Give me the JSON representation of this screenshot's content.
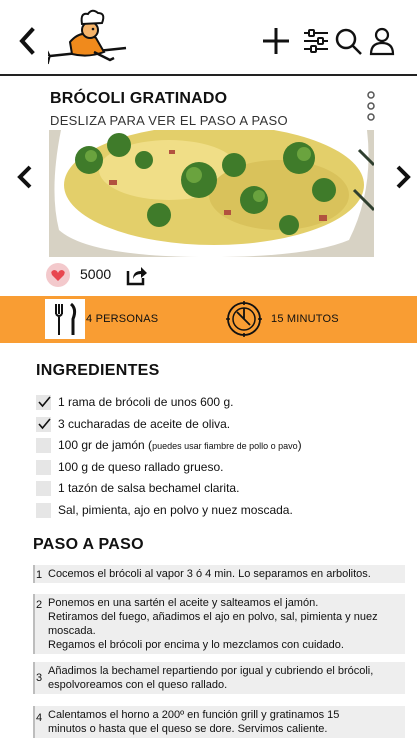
{
  "recipe": {
    "title": "BRÓCOLI GRATINADO",
    "subtitle": "DESLIZA PARA VER EL PASO A PASO",
    "likes": "5000"
  },
  "info": {
    "persons": "4 PERSONAS",
    "time": "15 MINUTOS"
  },
  "ingredients": {
    "heading": "INGREDIENTES",
    "items": [
      {
        "text": "1 rama de brócoli de unos 600 g.",
        "checked": true
      },
      {
        "text": "3 cucharadas de aceite de oliva.",
        "checked": true
      },
      {
        "text": "100 gr de jamón (",
        "note": "puedes usar fiambre de pollo o pavo",
        "suffix": ")",
        "checked": false
      },
      {
        "text": "100 g de queso rallado grueso.",
        "checked": false
      },
      {
        "text": "1 tazón de salsa bechamel clarita.",
        "checked": false
      },
      {
        "text": "Sal, pimienta, ajo en polvo y nuez moscada.",
        "checked": false
      }
    ]
  },
  "steps": {
    "heading": "PASO A PASO",
    "items": [
      {
        "num": "1",
        "lines": [
          "Cocemos el brócoli al vapor 3 ó 4 min.  Lo separamos en arbolitos."
        ]
      },
      {
        "num": "2",
        "lines": [
          "Ponemos en una sartén el aceite y salteamos el jamón.",
          "Retiramos del fuego, añadimos el ajo en polvo, sal, pimienta y nuez",
          "moscada.",
          "Regamos el brócoli por encima y lo mezclamos con cuidado."
        ]
      },
      {
        "num": "3",
        "lines": [
          "Añadimos la bechamel repartiendo por igual y cubriendo el brócoli,",
          "espolvoreamos con el queso rallado."
        ]
      },
      {
        "num": "4",
        "lines": [
          "Calentamos el horno a 200º en función grill y gratinamos 15",
          "minutos o hasta que el queso se dore. Servimos caliente."
        ]
      }
    ]
  },
  "colors": {
    "accent": "#f99d33",
    "like": "#e8464f"
  },
  "icons": {
    "back": "chevron-left-icon",
    "add": "plus-icon",
    "filter": "sliders-icon",
    "search": "search-icon",
    "profile": "user-icon",
    "more": "vertical-dots-icon",
    "prev": "chevron-left-icon",
    "next": "chevron-right-icon",
    "like": "heart-icon",
    "share": "share-icon",
    "persons": "cutlery-icon",
    "time": "clock-icon"
  }
}
